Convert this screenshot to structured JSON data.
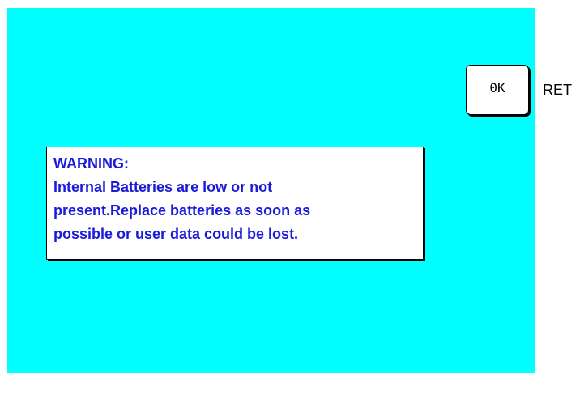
{
  "warning": {
    "title": "WARNING:",
    "lines": [
      "Internal Batteries are low or not",
      "present.Replace batteries as soon as",
      "possible or user data could be lost."
    ]
  },
  "ok_button": {
    "label": "0K"
  },
  "key_label": "RET",
  "colors": {
    "screen_background": "#00ffff",
    "warning_text": "#1a1adb",
    "box_background": "#ffffff"
  }
}
